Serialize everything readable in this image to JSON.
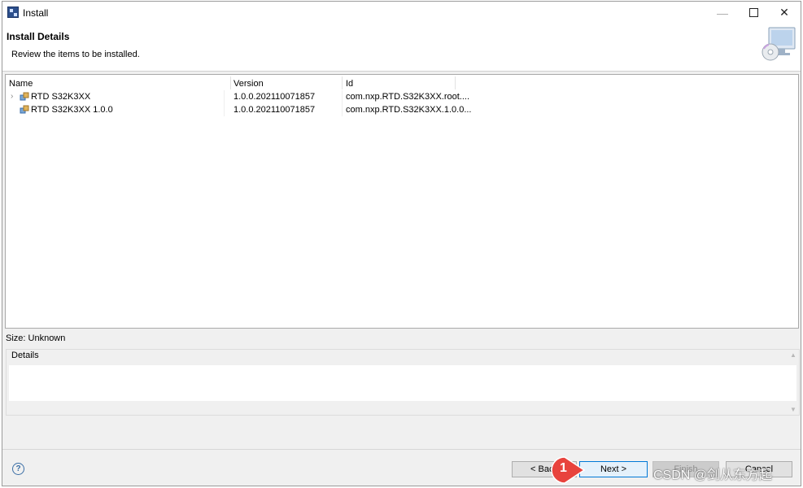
{
  "window": {
    "title": "Install"
  },
  "header": {
    "title": "Install Details",
    "description": "Review the items to be installed."
  },
  "table": {
    "columns": [
      "Name",
      "Version",
      "Id"
    ],
    "rows": [
      {
        "name": "RTD S32K3XX",
        "version": "1.0.0.202110071857",
        "id": "com.nxp.RTD.S32K3XX.root....",
        "expandable": true
      },
      {
        "name": "RTD S32K3XX 1.0.0",
        "version": "1.0.0.202110071857",
        "id": "com.nxp.RTD.S32K3XX.1.0.0...",
        "expandable": false
      }
    ]
  },
  "size_label": "Size: Unknown",
  "details": {
    "label": "Details",
    "text": ""
  },
  "footer": {
    "back": "< Back",
    "next": "Next >",
    "finish": "Finish",
    "cancel": "Cancel"
  },
  "annotation": {
    "step": "1"
  },
  "watermark": "CSDN @剑从东方起",
  "colors": {
    "badge": "#e8433d",
    "next_border": "#0078d7"
  },
  "icons": {
    "help": "help-icon",
    "close": "close-icon",
    "maximize": "maximize-icon",
    "minimize": "minimize-icon"
  }
}
